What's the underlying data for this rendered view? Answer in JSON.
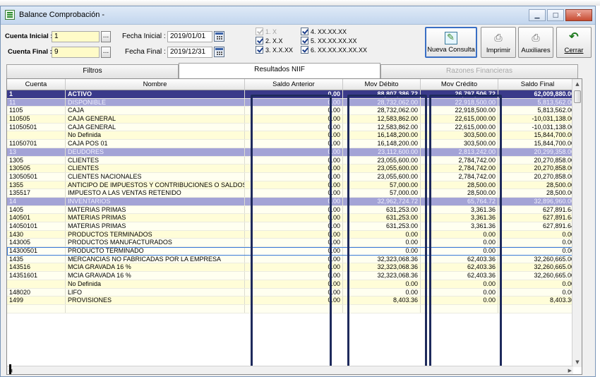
{
  "window": {
    "title": "Balance Comprobación -"
  },
  "params": {
    "cuenta_inicial_label": "Cuenta Inicial :",
    "cuenta_inicial_value": "1",
    "cuenta_final_label": "Cuenta Final :",
    "cuenta_final_value": "9",
    "fecha_inicial_label": "Fecha Inicial :",
    "fecha_inicial_value": "2019/01/01",
    "fecha_final_label": "Fecha Final :",
    "fecha_final_value": "2019/12/31",
    "dots": "..."
  },
  "levels": [
    {
      "label": "1. X",
      "checked": true,
      "enabled": false
    },
    {
      "label": "2. X.X",
      "checked": true,
      "enabled": true
    },
    {
      "label": "3. X.X.XX",
      "checked": true,
      "enabled": true
    },
    {
      "label": "4. XX.XX.XX",
      "checked": true,
      "enabled": true
    },
    {
      "label": "5. XX.XX.XX.XX",
      "checked": true,
      "enabled": true
    },
    {
      "label": "6. XX.XX.XX.XX.XX",
      "checked": true,
      "enabled": true
    }
  ],
  "toolbar": {
    "nueva_consulta": "Nueva Consulta",
    "imprimir": "Imprimir",
    "auxiliares": "Auxiliares",
    "cerrar": "Cerrar"
  },
  "tabs": [
    {
      "label": "Filtros",
      "active": false,
      "enabled": true
    },
    {
      "label": "Resultados NIIF",
      "active": true,
      "enabled": true
    },
    {
      "label": "Razones Financieras",
      "active": false,
      "enabled": false
    }
  ],
  "table": {
    "columns": [
      "Cuenta",
      "Nombre",
      "Saldo Anterior",
      "Mov Débito",
      "Mov Crédito",
      "Saldo Final"
    ],
    "rows": [
      {
        "type": "top",
        "cells": [
          "1",
          "ACTIVO",
          "0.00",
          "88,807,386.72",
          "26,797,506.72",
          "62,009,880.00"
        ]
      },
      {
        "type": "group",
        "cells": [
          "11",
          "DISPONIBLE",
          "0.00",
          "28,732,062.00",
          "22,918,500.00",
          "5,813,562.00"
        ]
      },
      {
        "type": "row",
        "cells": [
          "1105",
          "CAJA",
          "0.00",
          "28,732,062.00",
          "22,918,500.00",
          "5,813,562.00"
        ]
      },
      {
        "type": "row",
        "cells": [
          "110505",
          "CAJA GENERAL",
          "0.00",
          "12,583,862.00",
          "22,615,000.00",
          "-10,031,138.00"
        ]
      },
      {
        "type": "row",
        "cells": [
          "11050501",
          "CAJA GENERAL",
          "0.00",
          "12,583,862.00",
          "22,615,000.00",
          "-10,031,138.00"
        ]
      },
      {
        "type": "row",
        "cells": [
          "",
          "No Definida",
          "0.00",
          "16,148,200.00",
          "303,500.00",
          "15,844,700.00"
        ]
      },
      {
        "type": "row",
        "cells": [
          "11050701",
          "CAJA POS 01",
          "0.00",
          "16,148,200.00",
          "303,500.00",
          "15,844,700.00"
        ]
      },
      {
        "type": "group",
        "cells": [
          "13",
          "DEUDORES",
          "0.00",
          "23,112,600.00",
          "2,813,242.00",
          "20,299,358.00"
        ]
      },
      {
        "type": "row",
        "cells": [
          "1305",
          "CLIENTES",
          "0.00",
          "23,055,600.00",
          "2,784,742.00",
          "20,270,858.00"
        ]
      },
      {
        "type": "row",
        "cells": [
          "130505",
          "CLIENTES",
          "0.00",
          "23,055,600.00",
          "2,784,742.00",
          "20,270,858.00"
        ]
      },
      {
        "type": "row",
        "cells": [
          "13050501",
          "CLIENTES NACIONALES",
          "0.00",
          "23,055,600.00",
          "2,784,742.00",
          "20,270,858.00"
        ]
      },
      {
        "type": "row",
        "cells": [
          "1355",
          "ANTICIPO DE IMPUESTOS Y CONTRIBUCIONES O SALDOS A",
          "0.00",
          "57,000.00",
          "28,500.00",
          "28,500.00"
        ]
      },
      {
        "type": "row",
        "cells": [
          "135517",
          "IMPUESTO A LAS VENTAS RETENIDO",
          "0.00",
          "57,000.00",
          "28,500.00",
          "28,500.00"
        ]
      },
      {
        "type": "group",
        "cells": [
          "14",
          "INVENTARIOS",
          "0.00",
          "32,962,724.72",
          "65,764.72",
          "32,896,960.00"
        ]
      },
      {
        "type": "row",
        "cells": [
          "1405",
          "MATERIAS PRIMAS",
          "0.00",
          "631,253.00",
          "3,361.36",
          "627,891.64"
        ]
      },
      {
        "type": "row",
        "cells": [
          "140501",
          "MATERIAS PRIMAS",
          "0.00",
          "631,253.00",
          "3,361.36",
          "627,891.64"
        ]
      },
      {
        "type": "row",
        "cells": [
          "14050101",
          "MATERIAS PRIMAS",
          "0.00",
          "631,253.00",
          "3,361.36",
          "627,891.64"
        ]
      },
      {
        "type": "row",
        "cells": [
          "1430",
          "PRODUCTOS TERMINADOS",
          "0.00",
          "0.00",
          "0.00",
          "0.00"
        ]
      },
      {
        "type": "row",
        "cells": [
          "143005",
          "PRODUCTOS MANUFACTURADOS",
          "0.00",
          "0.00",
          "0.00",
          "0.00"
        ]
      },
      {
        "type": "focus",
        "cells": [
          "14300501",
          "PRODUCTO TERMINADO",
          "0.00",
          "0.00",
          "0.00",
          "0.00"
        ]
      },
      {
        "type": "row",
        "cells": [
          "1435",
          "MERCANCIAS NO FABRICADAS POR LA EMPRESA",
          "0.00",
          "32,323,068.36",
          "62,403.36",
          "32,260,665.00"
        ]
      },
      {
        "type": "row",
        "cells": [
          "143516",
          "MCIA GRAVADA 16 %",
          "0.00",
          "32,323,068.36",
          "62,403.36",
          "32,260,665.00"
        ]
      },
      {
        "type": "row",
        "cells": [
          "14351601",
          "MCIA GRAVADA 16 %",
          "0.00",
          "32,323,068.36",
          "62,403.36",
          "32,260,665.00"
        ]
      },
      {
        "type": "row",
        "cells": [
          "",
          "No Definida",
          "0.00",
          "0.00",
          "0.00",
          "0.00"
        ]
      },
      {
        "type": "row",
        "cells": [
          "148020",
          "LIFO",
          "0.00",
          "0.00",
          "0.00",
          "0.00"
        ]
      },
      {
        "type": "row",
        "cells": [
          "1499",
          "PROVISIONES",
          "0.00",
          "8,403.36",
          "0.00",
          "8,403.36"
        ]
      },
      {
        "type": "row",
        "cells": [
          "",
          "",
          "",
          "",
          "",
          ""
        ]
      }
    ]
  },
  "colors": {
    "top_row": "#3a3a8a",
    "group_row": "#a3a3d6",
    "highlight_border": "#1e2a5c"
  }
}
